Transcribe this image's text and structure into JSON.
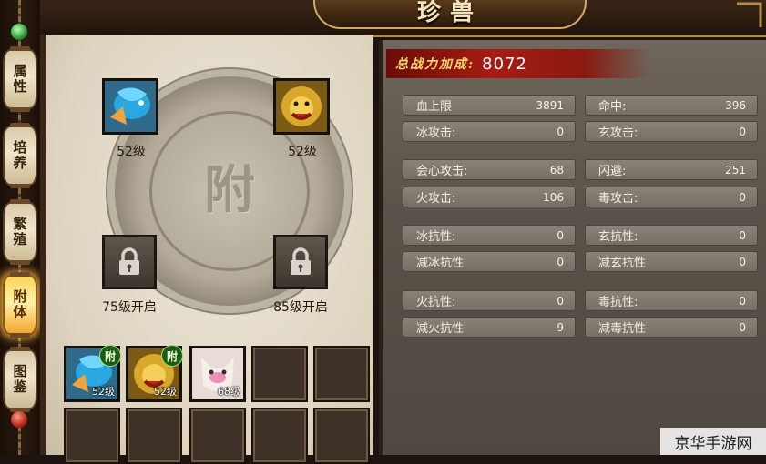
{
  "window": {
    "title": "珍兽"
  },
  "tabs": [
    {
      "label": "属性",
      "active": false
    },
    {
      "label": "培养",
      "active": false
    },
    {
      "label": "繁殖",
      "active": false
    },
    {
      "label": "附体",
      "active": true
    },
    {
      "label": "图鉴",
      "active": false
    }
  ],
  "attach": {
    "center_glyph": "附",
    "slots": [
      {
        "icon": "blue-fish-pet-icon",
        "level": "52级"
      },
      {
        "icon": "golden-lion-pet-icon",
        "level": "52级"
      },
      {
        "icon": "lock-icon",
        "level": "75级开启"
      },
      {
        "icon": "lock-icon",
        "level": "85级开启"
      }
    ]
  },
  "inventory": {
    "attached_tag": "附",
    "items": [
      {
        "icon": "blue-fish-pet-icon",
        "level": "52级",
        "attached": true
      },
      {
        "icon": "golden-lion-pet-icon",
        "level": "52级",
        "attached": true
      },
      {
        "icon": "pink-cat-pet-icon",
        "level": "68级",
        "attached": false
      }
    ]
  },
  "stats": {
    "power_label": "总战力加成:",
    "power_value": "8072",
    "rows": [
      {
        "name": "血上限",
        "value": "3891"
      },
      {
        "name": "命中:",
        "value": "396"
      },
      {
        "name": "冰攻击:",
        "value": "0"
      },
      {
        "name": "玄攻击:",
        "value": "0"
      },
      {
        "name": "会心攻击:",
        "value": "68"
      },
      {
        "name": "闪避:",
        "value": "251"
      },
      {
        "name": "火攻击:",
        "value": "106"
      },
      {
        "name": "毒攻击:",
        "value": "0"
      },
      {
        "name": "冰抗性:",
        "value": "0"
      },
      {
        "name": "玄抗性:",
        "value": "0"
      },
      {
        "name": "减冰抗性",
        "value": "0"
      },
      {
        "name": "减玄抗性",
        "value": "0"
      },
      {
        "name": "火抗性:",
        "value": "0"
      },
      {
        "name": "毒抗性:",
        "value": "0"
      },
      {
        "name": "减火抗性",
        "value": "9"
      },
      {
        "name": "减毒抗性",
        "value": "0"
      }
    ]
  },
  "watermark": "京华手游网",
  "colors": {
    "accent_gold": "#d4a860",
    "power_red": "#a81c14",
    "active_tab": "#ffd25a"
  }
}
